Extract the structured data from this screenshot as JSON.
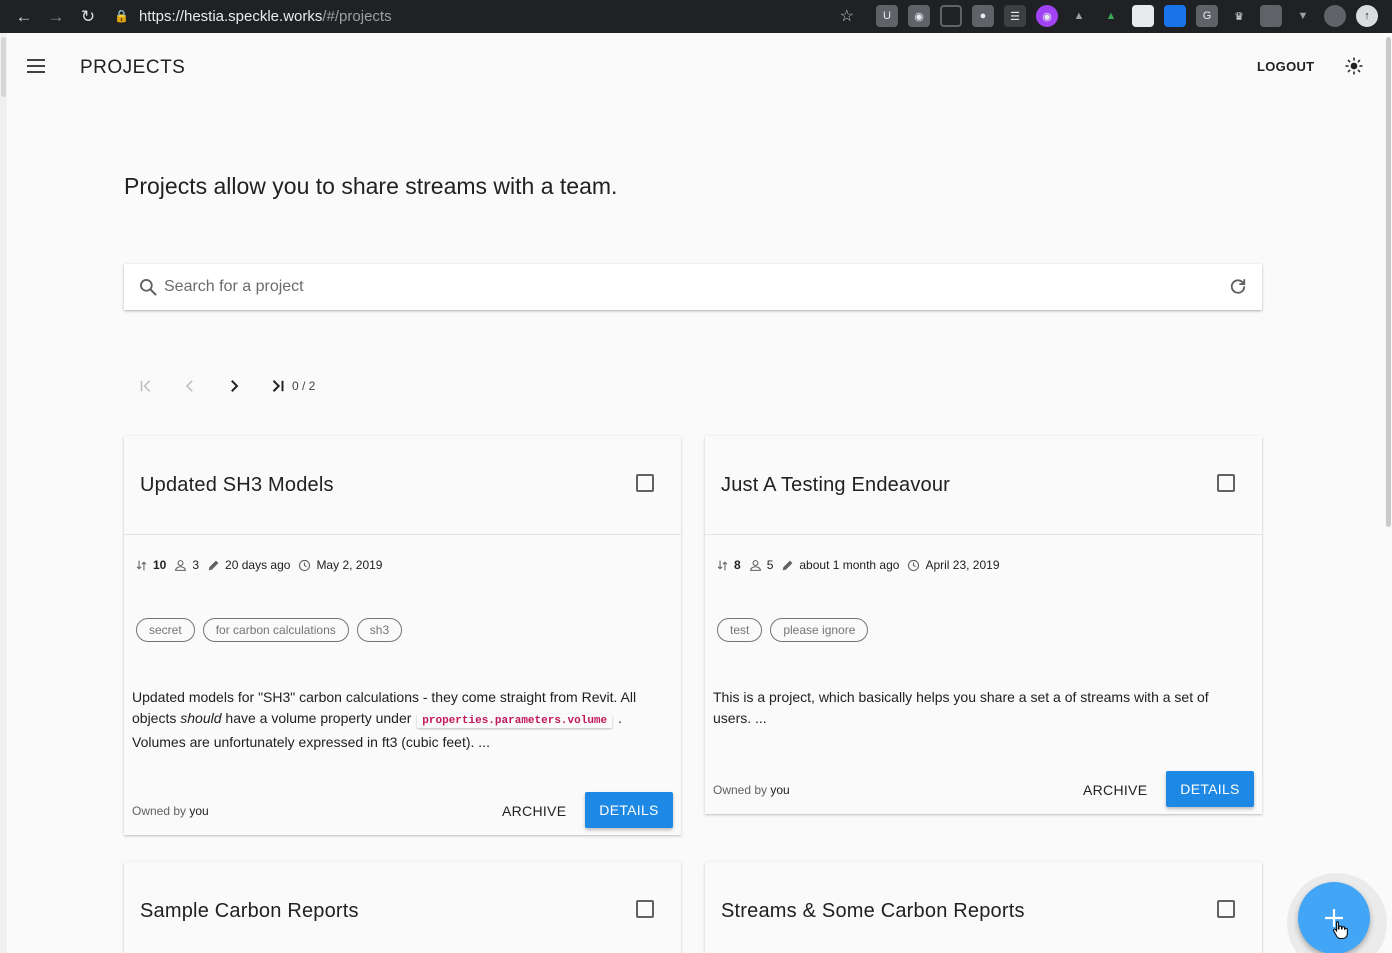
{
  "browser": {
    "url_host": "https://hestia.speckle.works",
    "url_path": "/#/projects",
    "back_icon": "arrow-left-icon",
    "forward_icon": "arrow-right-icon",
    "reload_icon": "reload-icon",
    "lock_icon": "lock-icon",
    "star_icon": "star-icon"
  },
  "appbar": {
    "title": "PROJECTS",
    "logout_label": "LOGOUT"
  },
  "intro": "Projects allow you to share streams with a team.",
  "search": {
    "placeholder": "Search for a project"
  },
  "pager": {
    "count": "0 / 2"
  },
  "cards": [
    {
      "title": "Updated SH3 Models",
      "streams": "10",
      "members": "3",
      "updated": "20 days ago",
      "created": "May 2, 2019",
      "tags": [
        "secret",
        "for carbon calculations",
        "sh3"
      ],
      "desc_1": "Updated models for \"SH3\" carbon calculations - they come straight from Revit. All objects ",
      "desc_em": "should",
      "desc_2": " have a volume property under ",
      "desc_code": "properties.parameters.volume",
      "desc_3": " . Volumes are unfortunately expressed in ft3 (cubic feet). ...",
      "owner_prefix": "Owned by",
      "owner": "you",
      "archive_label": "ARCHIVE",
      "details_label": "DETAILS"
    },
    {
      "title": "Just A Testing Endeavour",
      "streams": "8",
      "members": "5",
      "updated": "about 1 month ago",
      "created": "April 23, 2019",
      "tags": [
        "test",
        "please ignore"
      ],
      "desc": "This is a project, which basically helps you share a set a of streams with a set of users. ...",
      "owner_prefix": "Owned by",
      "owner": "you",
      "archive_label": "ARCHIVE",
      "details_label": "DETAILS"
    },
    {
      "title": "Sample Carbon Reports"
    },
    {
      "title": "Streams & Some Carbon Reports"
    }
  ]
}
